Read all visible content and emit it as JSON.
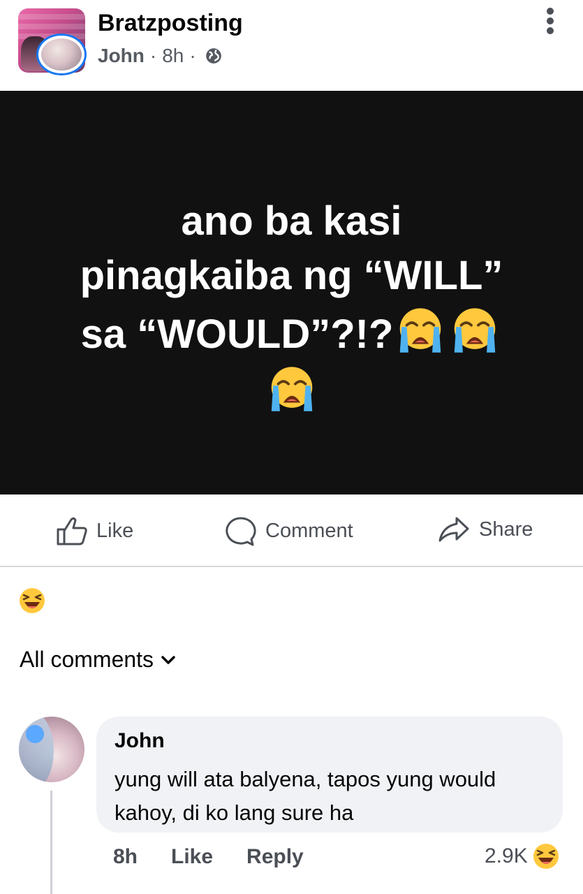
{
  "post": {
    "group_name": "Bratzposting",
    "author": "John",
    "separator": "·",
    "time": "8h",
    "privacy_icon": "globe-icon",
    "media_text": {
      "line1": "ano ba kasi",
      "line2": "pinagkaiba ng “WILL”",
      "line3": "sa “WOULD”?!?",
      "emoji": "loudly-crying-face"
    }
  },
  "actions": {
    "like": "Like",
    "comment": "Comment",
    "share": "Share"
  },
  "reactions": {
    "icon": "laughing-face-icon"
  },
  "comments": {
    "filter_label": "All comments",
    "items": [
      {
        "author": "John",
        "text": "yung will ata balyena, tapos yung would kahoy, di ko lang sure ha",
        "time": "8h",
        "like_label": "Like",
        "reply_label": "Reply",
        "reaction_count": "2.9K",
        "reaction_icon": "laughing-face-icon"
      }
    ]
  },
  "colors": {
    "accent": "#1877f2",
    "media_bg": "#111111",
    "bubble_bg": "#f0f2f5",
    "secondary_text": "#555a61"
  }
}
